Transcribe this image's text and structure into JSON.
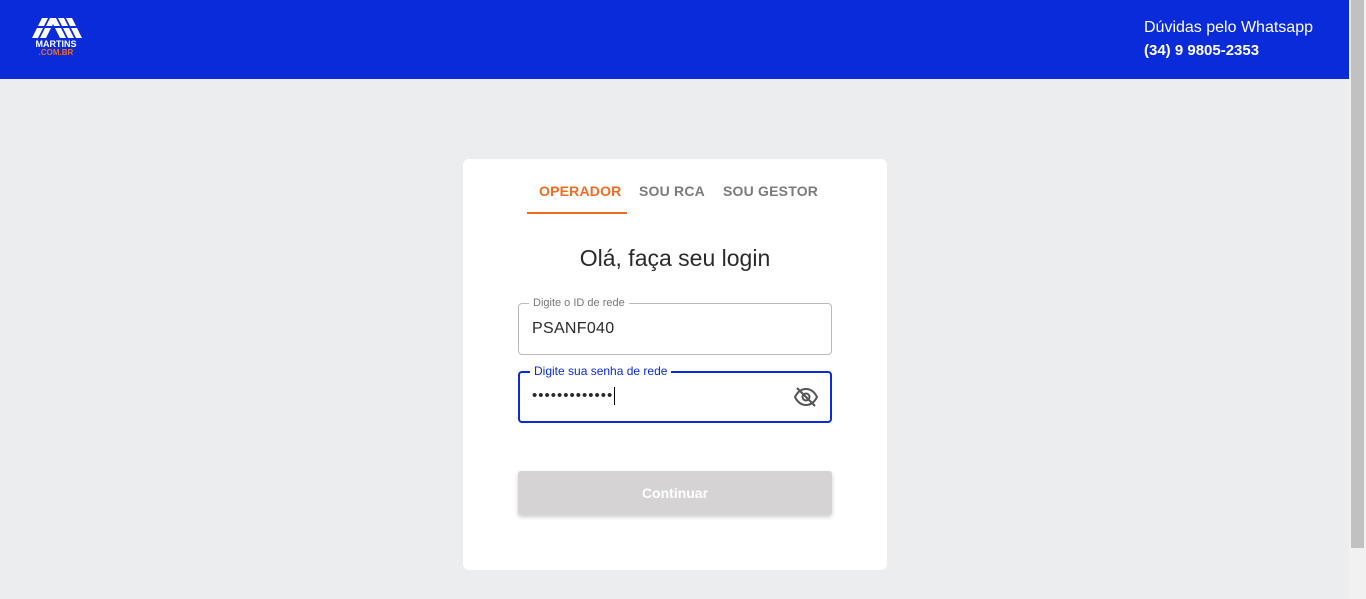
{
  "header": {
    "logo": {
      "name": "MARTINS",
      "sub": ".COM.BR"
    },
    "help_title": "Dúvidas pelo Whatsapp",
    "help_phone": "(34) 9 9805-2353"
  },
  "tabs": [
    {
      "label": "OPERADOR",
      "active": true
    },
    {
      "label": "SOU RCA",
      "active": false
    },
    {
      "label": "SOU GESTOR",
      "active": false
    }
  ],
  "login": {
    "title": "Olá, faça seu login",
    "id_field": {
      "label": "Digite o ID de rede",
      "value": "PSANF040"
    },
    "password_field": {
      "label": "Digite sua senha de rede",
      "value": "•••••••••••••",
      "icon": "eye-off-icon"
    },
    "submit_label": "Continuar"
  },
  "colors": {
    "header_bg": "#0a2bd9",
    "accent": "#f26b21",
    "page_bg": "#ecedef",
    "button_disabled": "#d5d3d4"
  }
}
